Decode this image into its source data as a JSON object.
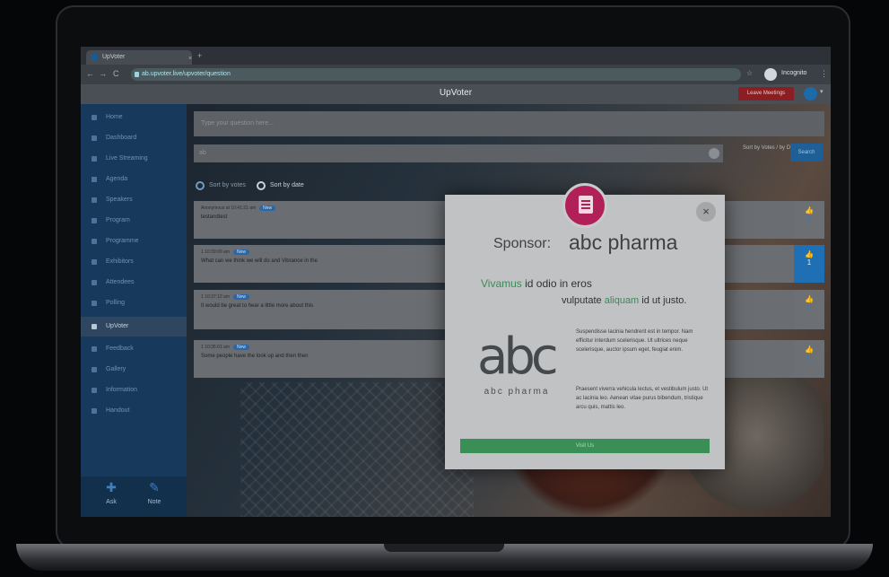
{
  "browser": {
    "tab_title": "UpVoter",
    "tab_close": "×",
    "new_tab": "+",
    "back": "←",
    "forward": "→",
    "reload": "C",
    "url": "ab.upvoter.live/upvoter/question",
    "star": "☆",
    "incognito_label": "Incognito",
    "menu": "⋮"
  },
  "app": {
    "title": "UpVoter",
    "leave_button": "Leave Meetings",
    "user_caret": "▾"
  },
  "sidebar": {
    "items": [
      {
        "label": "Home"
      },
      {
        "label": "Dashboard"
      },
      {
        "label": "Live Streaming"
      },
      {
        "label": "Agenda"
      },
      {
        "label": "Speakers"
      },
      {
        "label": "Program"
      },
      {
        "label": "Programme"
      },
      {
        "label": "Exhibitors"
      },
      {
        "label": "Attendees"
      },
      {
        "label": "Polling"
      },
      {
        "label": "UpVoter"
      },
      {
        "label": "Feedback"
      },
      {
        "label": "Gallery"
      },
      {
        "label": "Information"
      },
      {
        "label": "Handout"
      }
    ],
    "bottom": {
      "ask_label": "Ask",
      "note_label": "Note"
    }
  },
  "main": {
    "question_placeholder": "Type your question here...",
    "search_value": "ab",
    "sort_label": "Sort by Votes / by Date",
    "search_button": "Search",
    "radio_votes": "Sort by votes",
    "radio_date": "Sort by date",
    "questions": [
      {
        "meta": "Anonymous at 10:41:21 am",
        "badge": "New",
        "text": "testandtest",
        "votes": "0",
        "voted": false
      },
      {
        "meta": "1 10:39:09 am",
        "badge": "New",
        "text": "What can we think we will do and Vibrance in the",
        "votes": "1",
        "voted": true
      },
      {
        "meta": "1 10:37:12 am",
        "badge": "New",
        "text": "It would be great to hear a little more about this",
        "votes": "0",
        "voted": false
      },
      {
        "meta": "1 10:35:01 am",
        "badge": "New",
        "text": "Some people have the look up and then then",
        "votes": "0",
        "voted": false
      }
    ]
  },
  "modal": {
    "close": "×",
    "sponsor_label": "Sponsor:",
    "sponsor_name": "abc pharma",
    "headline1_highlight": "Vivamus",
    "headline1_rest": " id odio in eros",
    "headline2_pre": "vulputate ",
    "headline2_highlight": "aliquam",
    "headline2_rest": " id ut justo.",
    "logo_text": "abc",
    "logo_subtext": "abc pharma",
    "paragraph1": "Suspendisse lacinia hendrerit est in tempor. Nam efficitur interdum scelerisque. Ut ultrices neque scelerisque, auctor ipsum eget, feugiat enim.",
    "paragraph2": "Praesent viverra vehicula lectus, et vestibulum justo. Ut ac lacinia leo. Aenean vitae purus bibendum, tristique arcu quis, mattis leo.",
    "button": "Visit Us"
  }
}
